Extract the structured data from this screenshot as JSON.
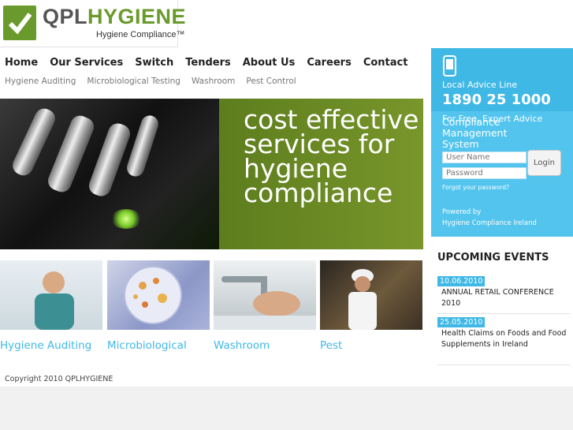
{
  "logo": {
    "brand_a": "QPL",
    "brand_b": "HYGIENE",
    "tagline": "Hygiene Compliance™"
  },
  "nav": {
    "main": [
      "Home",
      "Our Services",
      "Switch",
      "Tenders",
      "About Us",
      "Careers",
      "Contact"
    ],
    "sub": [
      "Hygiene Auditing",
      "Microbiological Testing",
      "Washroom",
      "Pest Control"
    ]
  },
  "contact": {
    "advice_label": "Local Advice Line",
    "phone": "1890 25 1000",
    "free_advice": "For Free, Expert Advice"
  },
  "cms": {
    "title": "Compliance Management System",
    "username_placeholder": "User Name",
    "password_placeholder": "Password",
    "login": "Login",
    "forgot": "Forgot your password?",
    "powered_by": "Powered by",
    "powered_name": "Hygiene Compliance Ireland"
  },
  "hero": {
    "text": "cost effective services for hygiene compliance"
  },
  "services": [
    "Hygiene Auditing",
    "Microbiological",
    "Washroom",
    "Pest"
  ],
  "events": {
    "title": "UPCOMING EVENTS",
    "items": [
      {
        "date": "10.06.2010",
        "text": "ANNUAL RETAIL CONFERENCE 2010"
      },
      {
        "date": "25.05.2010",
        "text": "Health Claims on Foods and Food Supplements in Ireland"
      }
    ]
  },
  "footer": {
    "copyright": "Copyright 2010 QPLHYGIENE"
  },
  "colors": {
    "accent_blue": "#3fb8e6",
    "brand_green": "#6a9a2b"
  }
}
